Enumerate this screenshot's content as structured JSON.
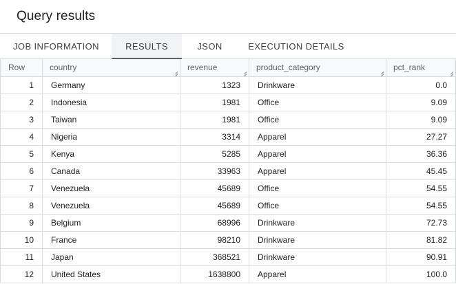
{
  "header": {
    "title": "Query results"
  },
  "tabs": [
    {
      "label": "JOB INFORMATION",
      "active": false
    },
    {
      "label": "RESULTS",
      "active": true
    },
    {
      "label": "JSON",
      "active": false
    },
    {
      "label": "EXECUTION DETAILS",
      "active": false
    }
  ],
  "table": {
    "columns": [
      "Row",
      "country",
      "revenue",
      "product_category",
      "pct_rank"
    ],
    "rows": [
      [
        "1",
        "Germany",
        "1323",
        "Drinkware",
        "0.0"
      ],
      [
        "2",
        "Indonesia",
        "1981",
        "Office",
        "9.09"
      ],
      [
        "3",
        "Taiwan",
        "1981",
        "Office",
        "9.09"
      ],
      [
        "4",
        "Nigeria",
        "3314",
        "Apparel",
        "27.27"
      ],
      [
        "5",
        "Kenya",
        "5285",
        "Apparel",
        "36.36"
      ],
      [
        "6",
        "Canada",
        "33963",
        "Apparel",
        "45.45"
      ],
      [
        "7",
        "Venezuela",
        "45689",
        "Office",
        "54.55"
      ],
      [
        "8",
        "Venezuela",
        "45689",
        "Office",
        "54.55"
      ],
      [
        "9",
        "Belgium",
        "68996",
        "Drinkware",
        "72.73"
      ],
      [
        "10",
        "France",
        "98210",
        "Drinkware",
        "81.82"
      ],
      [
        "11",
        "Japan",
        "368521",
        "Drinkware",
        "90.91"
      ],
      [
        "12",
        "United States",
        "1638800",
        "Apparel",
        "100.0"
      ]
    ]
  }
}
